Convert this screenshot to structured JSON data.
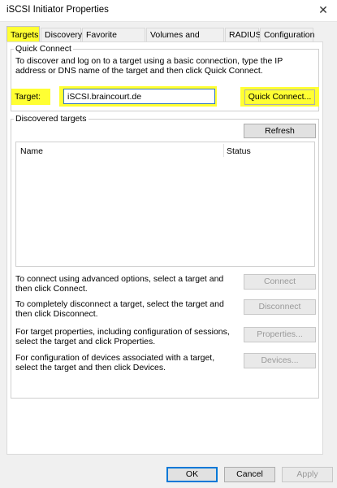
{
  "window": {
    "title": "iSCSI Initiator Properties",
    "close_glyph": "✕"
  },
  "tabs": [
    {
      "label": "Targets",
      "active": true
    },
    {
      "label": "Discovery"
    },
    {
      "label": "Favorite Targets"
    },
    {
      "label": "Volumes and Devices"
    },
    {
      "label": "RADIUS"
    },
    {
      "label": "Configuration"
    }
  ],
  "quick_connect": {
    "legend": "Quick Connect",
    "description": "To discover and log on to a target using a basic connection, type the IP address or DNS name of the target and then click Quick Connect.",
    "target_label": "Target:",
    "target_value": "iSCSI.braincourt.de",
    "button": "Quick Connect..."
  },
  "discovered": {
    "legend": "Discovered targets",
    "refresh": "Refresh",
    "columns": [
      "Name",
      "Status"
    ],
    "rows": []
  },
  "actions": [
    {
      "description": "To connect using advanced options, select a target and then click Connect.",
      "button": "Connect"
    },
    {
      "description": "To completely disconnect a target, select the target and then click Disconnect.",
      "button": "Disconnect"
    },
    {
      "description": "For target properties, including configuration of sessions, select the target and click Properties.",
      "button": "Properties..."
    },
    {
      "description": "For configuration of devices associated with a target, select the target and then click Devices.",
      "button": "Devices..."
    }
  ],
  "footer": {
    "ok": "OK",
    "cancel": "Cancel",
    "apply": "Apply"
  },
  "colors": {
    "highlight": "#ffff33",
    "focus_border": "#2f74c0",
    "ok_border": "#0078d7"
  }
}
